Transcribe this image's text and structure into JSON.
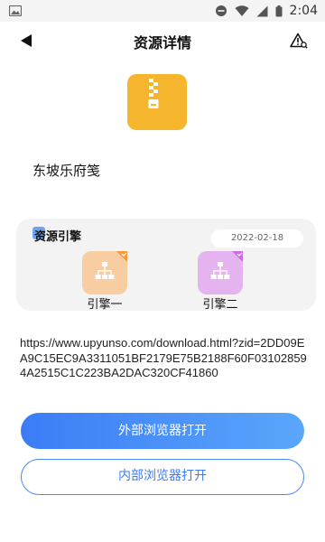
{
  "status_bar": {
    "time": "2:04",
    "icons": [
      "image-icon",
      "dnd-icon",
      "wifi-icon",
      "signal-icon",
      "battery-icon"
    ]
  },
  "header": {
    "title": "资源详情",
    "back_icon": "back-arrow-icon",
    "report_icon": "warning-icon"
  },
  "resource": {
    "icon": "zip-file-icon",
    "icon_color": "#f5b62e",
    "name": "东坡乐府笺",
    "url": "https://www.upyunso.com/download.html?zid=2DD09EA9C15EC9A3311051BF2179E75B2188F60F031028594A2515C1C223BA2DAC320CF41860"
  },
  "engines": {
    "title": "资源引擎",
    "date": "2022-02-18",
    "items": [
      {
        "label": "引擎一",
        "icon": "network-icon",
        "color": "#f8cda2"
      },
      {
        "label": "引擎二",
        "icon": "network-icon",
        "color": "#e5b3f0"
      }
    ]
  },
  "actions": {
    "external": "外部浏览器打开",
    "internal": "内部浏览器打开",
    "accent": "#3b7cf6"
  }
}
